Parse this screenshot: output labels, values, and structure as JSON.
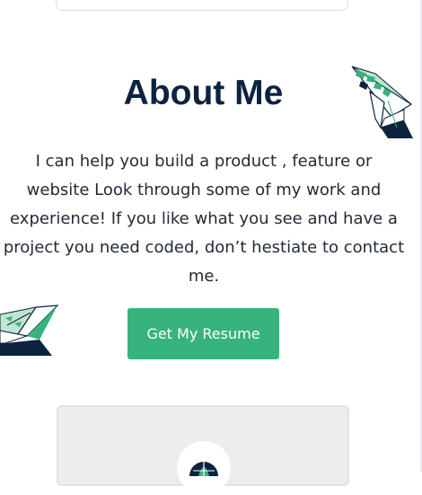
{
  "about": {
    "title": "About Me",
    "lines": [
      "I can help you build a product , feature or",
      "website Look through some of my work and",
      "experience! If you like what you see and have a",
      "project you need coded, don’t hestiate to contact",
      "me."
    ],
    "resume_button_label": "Get My Resume"
  },
  "decorations": {
    "top_right_icon": "paper-plane-origami-icon",
    "left_icon": "paper-plane-origami-icon",
    "project_icon": "globe-icon"
  },
  "colors": {
    "heading": "#0c2340",
    "body_text": "#222b36",
    "accent_green": "#37b37e",
    "navy": "#0c2340",
    "light_green": "#bfe6cf"
  }
}
